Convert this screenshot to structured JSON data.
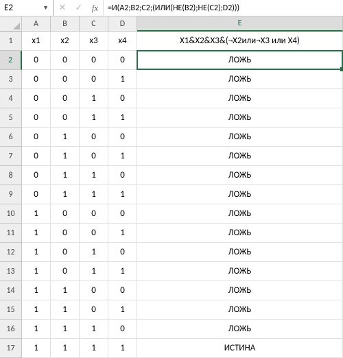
{
  "formula_bar": {
    "cell_ref": "E2",
    "formula": "=И(A2;B2;C2;(ИЛИ(НЕ(B2);НЕ(C2);D2)))"
  },
  "columns": [
    "A",
    "B",
    "C",
    "D",
    "E"
  ],
  "rows": [
    {
      "n": "1",
      "A": "x1",
      "B": "x2",
      "C": "x3",
      "D": "x4",
      "E": "X1&X2&X3&(¬X2или¬X3 или X4)"
    },
    {
      "n": "2",
      "A": "0",
      "B": "0",
      "C": "0",
      "D": "0",
      "E": "ЛОЖЬ"
    },
    {
      "n": "3",
      "A": "0",
      "B": "0",
      "C": "0",
      "D": "1",
      "E": "ЛОЖЬ"
    },
    {
      "n": "4",
      "A": "0",
      "B": "0",
      "C": "1",
      "D": "0",
      "E": "ЛОЖЬ"
    },
    {
      "n": "5",
      "A": "0",
      "B": "0",
      "C": "1",
      "D": "1",
      "E": "ЛОЖЬ"
    },
    {
      "n": "6",
      "A": "0",
      "B": "1",
      "C": "0",
      "D": "0",
      "E": "ЛОЖЬ"
    },
    {
      "n": "7",
      "A": "0",
      "B": "1",
      "C": "0",
      "D": "1",
      "E": "ЛОЖЬ"
    },
    {
      "n": "8",
      "A": "0",
      "B": "1",
      "C": "1",
      "D": "0",
      "E": "ЛОЖЬ"
    },
    {
      "n": "9",
      "A": "0",
      "B": "1",
      "C": "1",
      "D": "1",
      "E": "ЛОЖЬ"
    },
    {
      "n": "10",
      "A": "1",
      "B": "0",
      "C": "0",
      "D": "0",
      "E": "ЛОЖЬ"
    },
    {
      "n": "11",
      "A": "1",
      "B": "0",
      "C": "0",
      "D": "1",
      "E": "ЛОЖЬ"
    },
    {
      "n": "12",
      "A": "1",
      "B": "0",
      "C": "1",
      "D": "0",
      "E": "ЛОЖЬ"
    },
    {
      "n": "13",
      "A": "1",
      "B": "0",
      "C": "1",
      "D": "1",
      "E": "ЛОЖЬ"
    },
    {
      "n": "14",
      "A": "1",
      "B": "1",
      "C": "0",
      "D": "0",
      "E": "ЛОЖЬ"
    },
    {
      "n": "15",
      "A": "1",
      "B": "1",
      "C": "0",
      "D": "1",
      "E": "ЛОЖЬ"
    },
    {
      "n": "16",
      "A": "1",
      "B": "1",
      "C": "1",
      "D": "0",
      "E": "ЛОЖЬ"
    },
    {
      "n": "17",
      "A": "1",
      "B": "1",
      "C": "1",
      "D": "1",
      "E": "ИСТИНА"
    }
  ],
  "selected_cell": {
    "col": "E",
    "row": "2"
  }
}
